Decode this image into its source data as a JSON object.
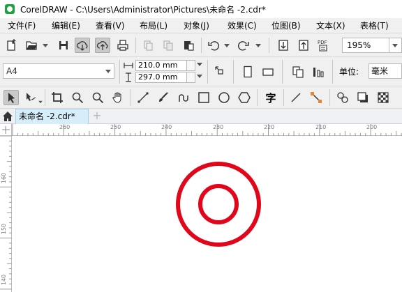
{
  "window": {
    "title": "CorelDRAW - C:\\Users\\Administrator\\Pictures\\未命名 -2.cdr*"
  },
  "menu": [
    {
      "label": "文件(F)"
    },
    {
      "label": "编辑(E)"
    },
    {
      "label": "查看(V)"
    },
    {
      "label": "布局(L)"
    },
    {
      "label": "对象(J)"
    },
    {
      "label": "效果(C)"
    },
    {
      "label": "位图(B)"
    },
    {
      "label": "文本(X)"
    },
    {
      "label": "表格(T)"
    }
  ],
  "toolbar": {
    "zoom": "195%",
    "pdf_label": "PDF",
    "icons": [
      "new-document-icon",
      "open-folder-icon",
      "save-icon",
      "cloud-download-icon",
      "cloud-upload-icon",
      "print-icon",
      "cut-icon",
      "copy-icon",
      "paste-icon",
      "undo-icon",
      "redo-icon",
      "import-icon",
      "export-icon",
      "publish-pdf-icon"
    ]
  },
  "property_bar": {
    "page_size": "A4",
    "width": "210.0 mm",
    "height": "297.0 mm",
    "unit_label": "单位:",
    "unit_value": "毫米"
  },
  "toolbox": {
    "icons": [
      "pick-tool-icon",
      "shape-tool-icon",
      "crop-tool-icon",
      "zoom-tool-icon",
      "zoom-out-icon",
      "pan-tool-icon",
      "line-tool-icon",
      "brush-tool-icon",
      "curve-tool-icon",
      "rectangle-tool-icon",
      "ellipse-tool-icon",
      "polygon-tool-icon",
      "text-tool-icon",
      "connector-tool-icon",
      "dimension-tool-icon",
      "blend-tool-icon",
      "shadow-tool-icon",
      "transparency-tool-icon"
    ],
    "text_tool_glyph": "字"
  },
  "document_tabs": {
    "active": "未命名 -2.cdr*",
    "new_tab": "+"
  },
  "ruler": {
    "h_labels": [
      "260",
      "250",
      "240",
      "230",
      "220",
      "210",
      "200"
    ],
    "v_labels": [
      "160",
      "150",
      "140"
    ]
  },
  "colors": {
    "ring": "#e2061b",
    "tab_active": "#d6eefa",
    "chrome": "#f0f0f0"
  }
}
